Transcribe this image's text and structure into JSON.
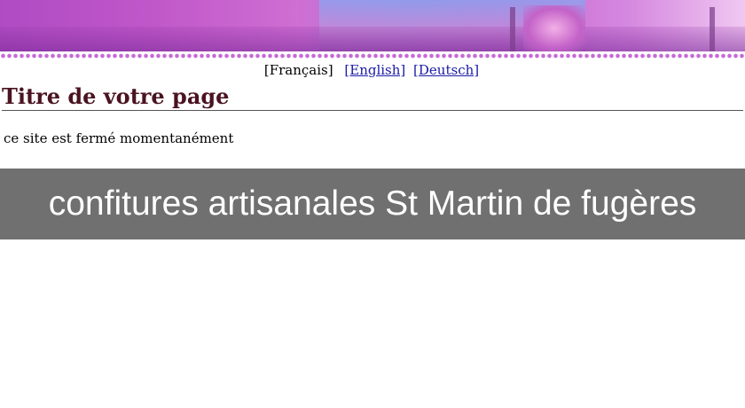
{
  "lang_switch": {
    "current": "[Français]",
    "links": [
      "[English]",
      "[Deutsch]"
    ]
  },
  "page": {
    "title": "Titre de votre page",
    "message": "ce site est fermé momentanément"
  },
  "caption": "confitures artisanales St Martin de fugères",
  "colors": {
    "banner_accent": "#c057c9",
    "title": "#4a1420",
    "link": "#1a1aa6",
    "caption_bar": "#707070"
  }
}
